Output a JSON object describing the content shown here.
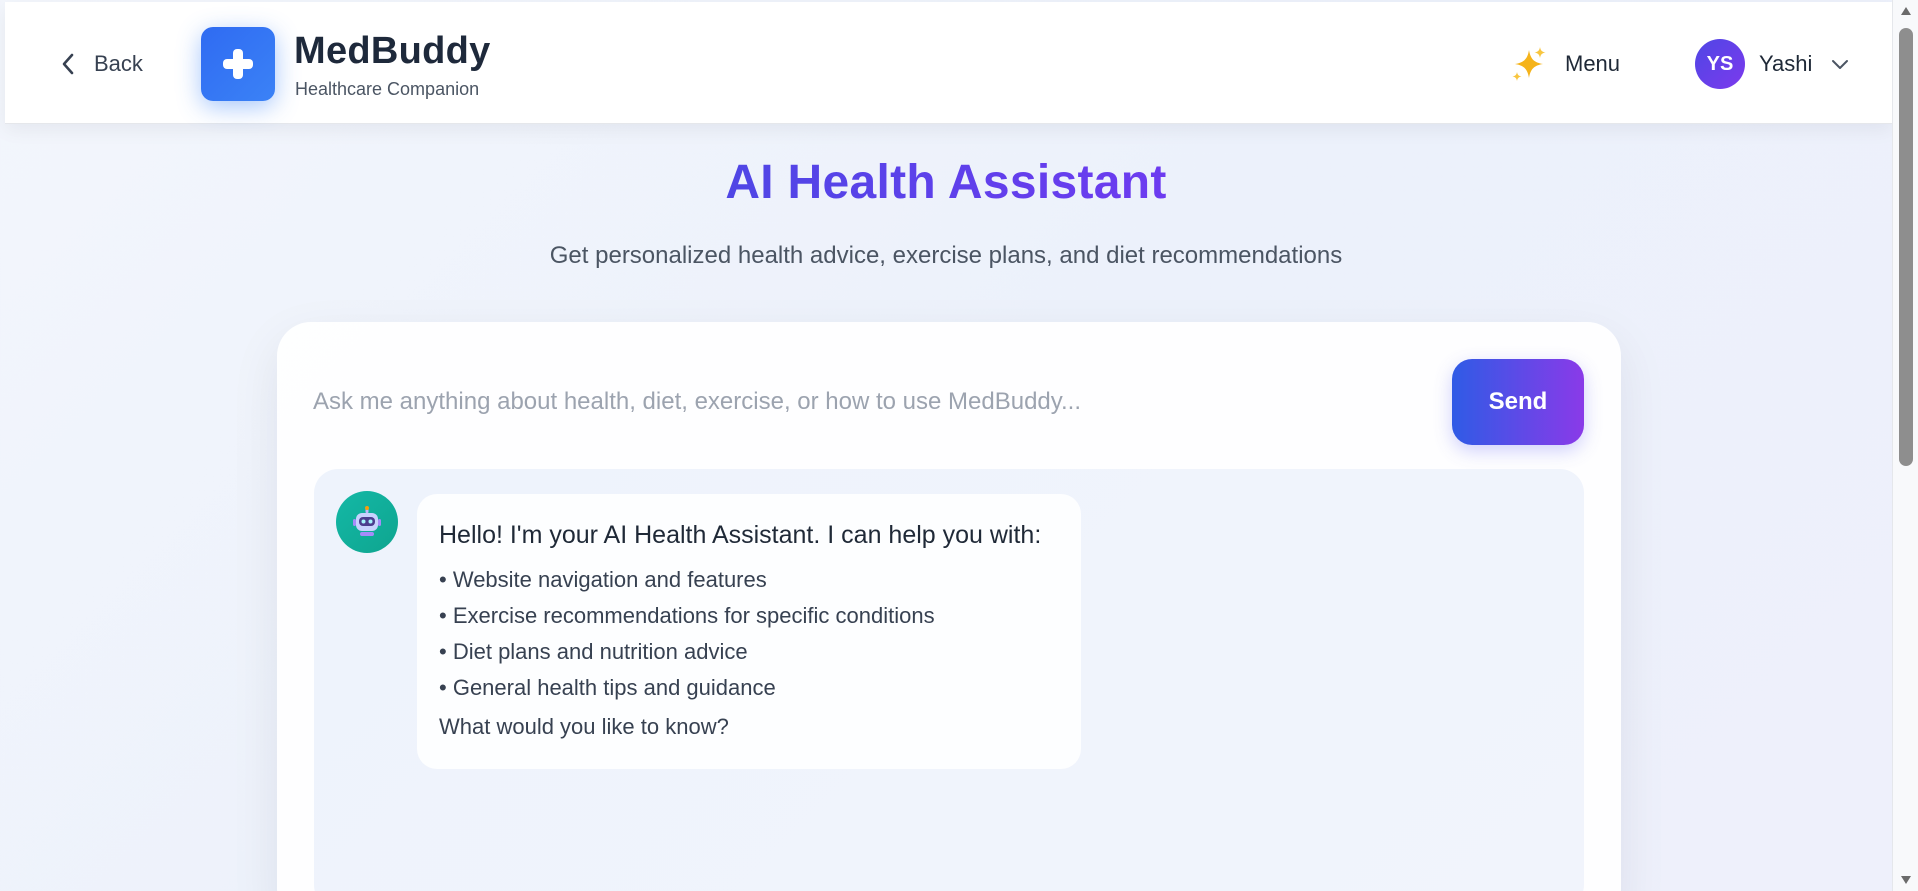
{
  "header": {
    "back_label": "Back",
    "brand_name": "MedBuddy",
    "brand_tagline": "Healthcare Companion",
    "logo_icon": "plus-icon",
    "menu_label": "Menu",
    "menu_icon": "sparkles-icon",
    "user": {
      "initials": "YS",
      "name": "Yashi"
    }
  },
  "main": {
    "title": "AI Health Assistant",
    "subtitle": "Get personalized health advice, exercise plans, and diet recommendations"
  },
  "chat": {
    "input_placeholder": "Ask me anything about health, diet, exercise, or how to use MedBuddy...",
    "input_value": "",
    "send_label": "Send",
    "messages": [
      {
        "sender": "bot",
        "avatar_icon": "robot-icon",
        "greeting": "Hello! I'm your AI Health Assistant. I can help you with:",
        "items": [
          "Website navigation and features",
          "Exercise recommendations for specific conditions",
          "Diet plans and nutrition advice",
          "General health tips and guidance"
        ],
        "closing": "What would you like to know?"
      }
    ]
  },
  "colors": {
    "brand_blue": "#3b82f6",
    "title_purple": "#5a3ee8",
    "send_gradient_start": "#2f5be6",
    "send_gradient_end": "#8a3ae8",
    "bot_avatar": "#14b8a6",
    "user_avatar": "#4f46e5"
  }
}
